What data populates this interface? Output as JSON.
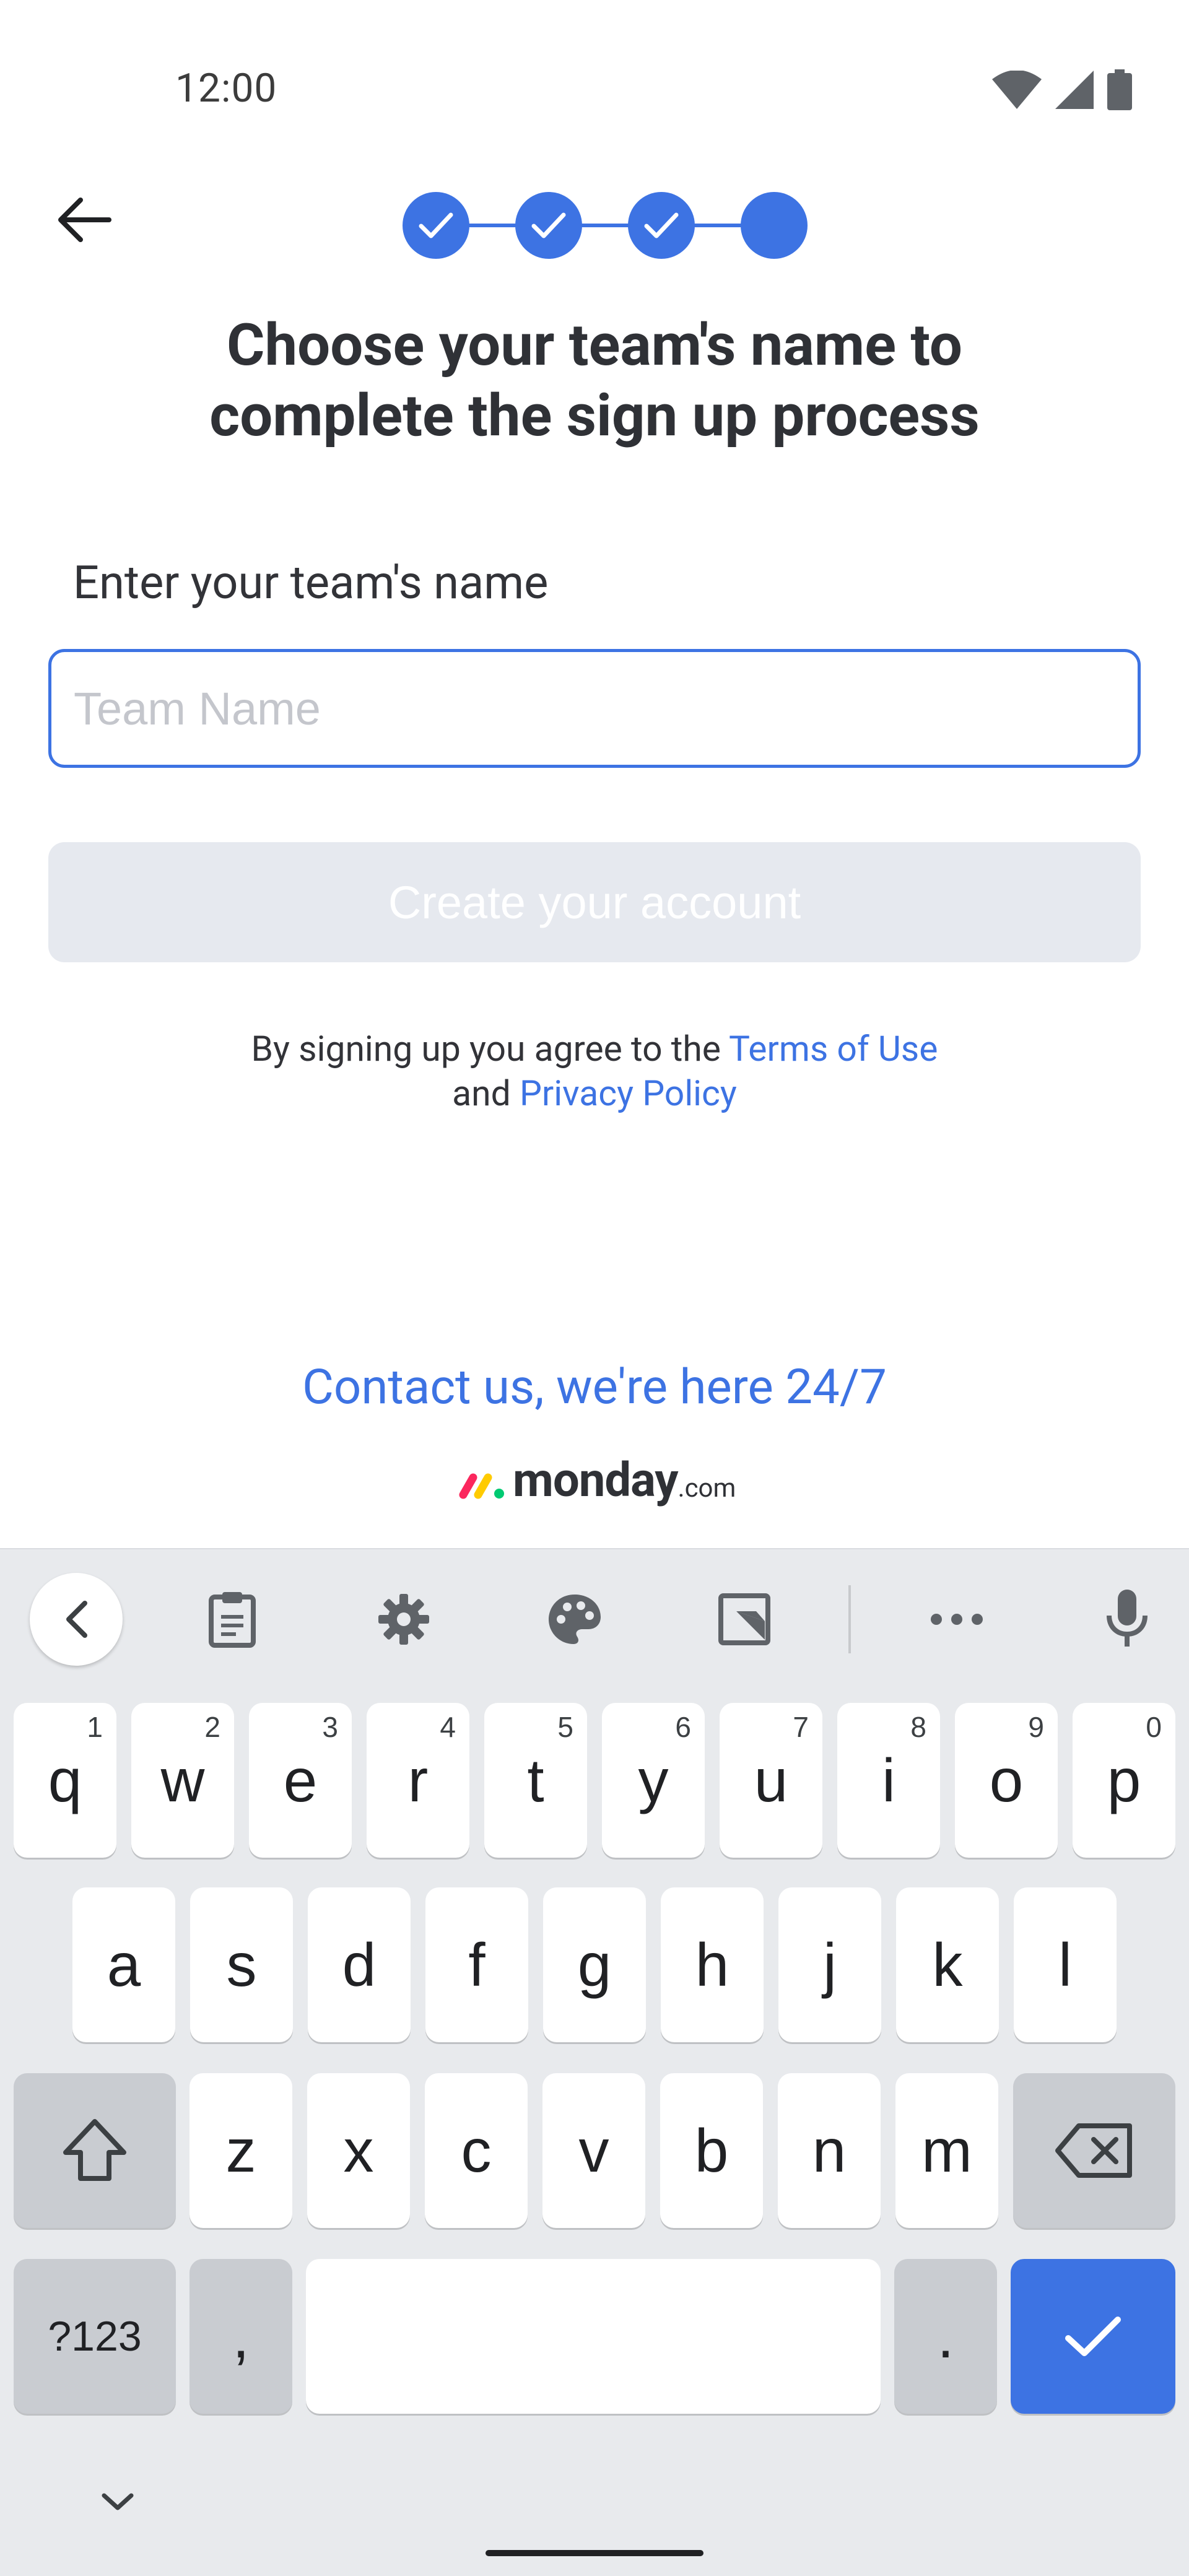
{
  "status_bar": {
    "time": "12:00",
    "icons": [
      "wifi-icon",
      "signal-icon",
      "battery-icon"
    ]
  },
  "header": {
    "back_icon": "arrow-back-icon",
    "steps": [
      {
        "state": "completed"
      },
      {
        "state": "completed"
      },
      {
        "state": "completed"
      },
      {
        "state": "current"
      }
    ]
  },
  "title_line1": "Choose your team's name to",
  "title_line2": "complete the sign up process",
  "form": {
    "label": "Enter your team's name",
    "team_name_value": "",
    "team_name_placeholder": "Team Name",
    "submit_label": "Create your account"
  },
  "terms": {
    "prefix": "By signing up you agree to the ",
    "terms_link": "Terms of Use",
    "middle": "and ",
    "privacy_link": "Privacy Policy"
  },
  "contact_link": "Contact us, we're here 24/7",
  "logo": {
    "word": "monday",
    "suffix": ".com"
  },
  "colors": {
    "accent": "#3d73e3",
    "text": "#323338",
    "disabled": "#e6e9ef",
    "keyboard_bg": "#e8eaed"
  },
  "keyboard": {
    "toolbar": [
      "chevron-left-icon",
      "clipboard-icon",
      "gear-icon",
      "palette-icon",
      "floating-keyboard-icon",
      "more-icon",
      "mic-icon"
    ],
    "row1": [
      {
        "k": "q",
        "h": "1"
      },
      {
        "k": "w",
        "h": "2"
      },
      {
        "k": "e",
        "h": "3"
      },
      {
        "k": "r",
        "h": "4"
      },
      {
        "k": "t",
        "h": "5"
      },
      {
        "k": "y",
        "h": "6"
      },
      {
        "k": "u",
        "h": "7"
      },
      {
        "k": "i",
        "h": "8"
      },
      {
        "k": "o",
        "h": "9"
      },
      {
        "k": "p",
        "h": "0"
      }
    ],
    "row2": [
      "a",
      "s",
      "d",
      "f",
      "g",
      "h",
      "j",
      "k",
      "l"
    ],
    "row3": [
      "z",
      "x",
      "c",
      "v",
      "b",
      "n",
      "m"
    ],
    "symbols_label": "?123",
    "comma": ",",
    "period": "."
  }
}
